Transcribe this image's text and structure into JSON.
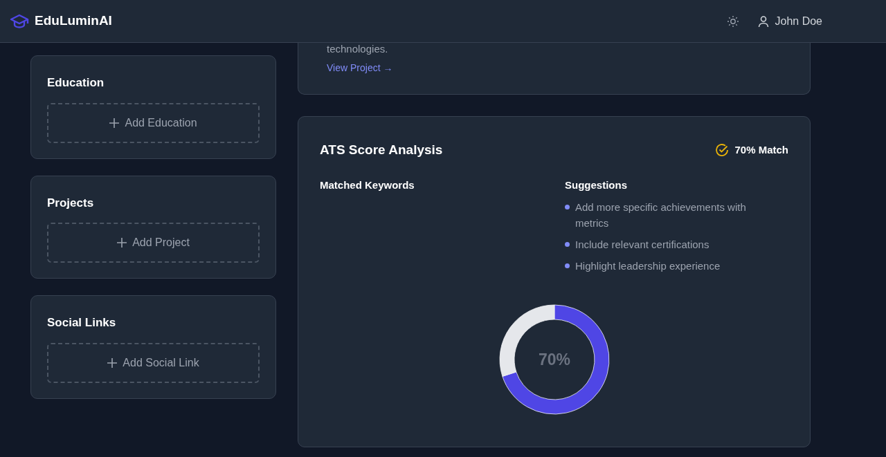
{
  "brand": {
    "name": "EduLuminAI"
  },
  "user": {
    "name": "John Doe"
  },
  "sections": [
    {
      "title": "Education",
      "action": "Add Education"
    },
    {
      "title": "Projects",
      "action": "Add Project"
    },
    {
      "title": "Social Links",
      "action": "Add Social Link"
    }
  ],
  "project_card": {
    "text": "technologies.",
    "link": "View Project →"
  },
  "ats": {
    "title": "ATS Score Analysis",
    "match": "70% Match",
    "keywords_title": "Matched Keywords",
    "suggestions_title": "Suggestions",
    "suggestions": [
      "Add more specific achievements with metrics",
      "Include relevant certifications",
      "Highlight leadership experience"
    ],
    "score": {
      "label": "70%",
      "chart_data": {
        "type": "donut",
        "values": [
          70,
          30
        ],
        "colors": [
          "#4f46e5",
          "#e5e7eb"
        ]
      }
    }
  }
}
